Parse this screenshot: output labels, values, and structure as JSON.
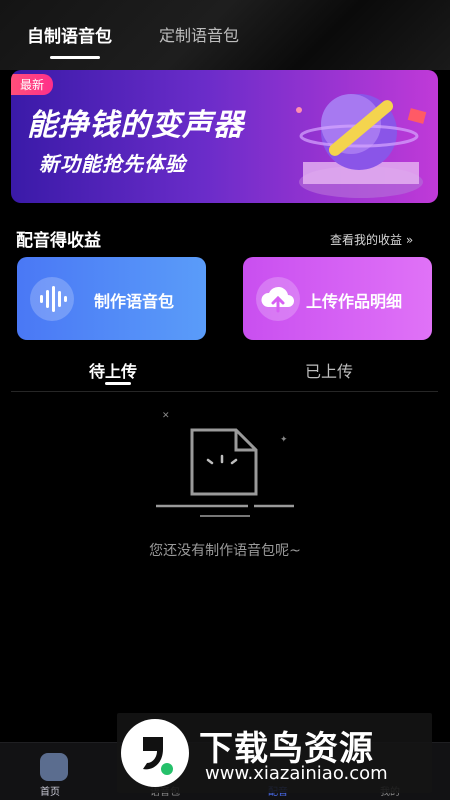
{
  "tabs": {
    "active": "自制语音包",
    "inactive": "定制语音包"
  },
  "banner": {
    "badge": "最新",
    "title": "能挣钱的变声器",
    "subtitle": "新功能抢先体验"
  },
  "earnings": {
    "title": "配音得收益",
    "link": "查看我的收益 »"
  },
  "cards": {
    "make": "制作语音包",
    "upload": "上传作品明细"
  },
  "subtabs": {
    "pending": "待上传",
    "uploaded": "已上传"
  },
  "empty": {
    "message": "您还没有制作语音包呢~"
  },
  "bottom_nav": {
    "home": "首页",
    "voice": "语音包",
    "dub": "配音",
    "mine": "我的"
  },
  "watermark": {
    "title": "下载鸟资源",
    "url": "www.xiazainiao.com"
  },
  "colors": {
    "make_card": "#4a78f5",
    "upload_card": "#c94ff0",
    "accent": "#4a6cf0",
    "banner": "#6a2cc9"
  }
}
